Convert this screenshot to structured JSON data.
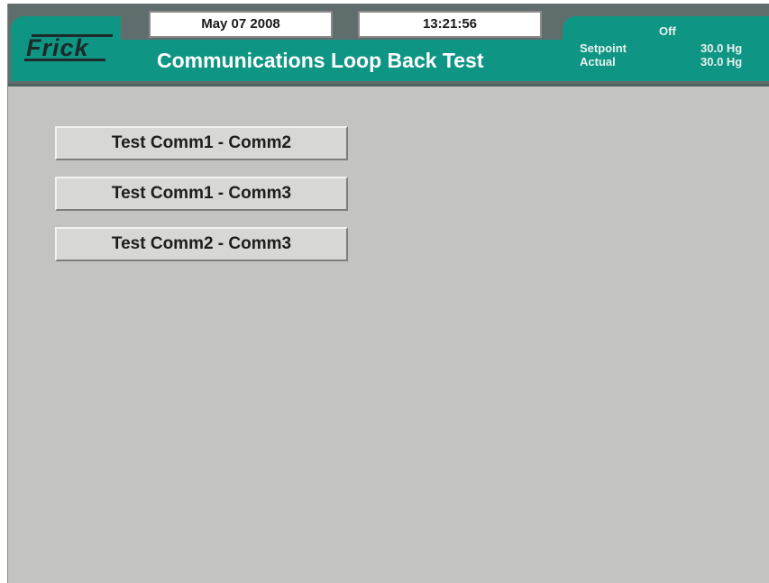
{
  "header": {
    "date": "May 07 2008",
    "time": "13:21:56",
    "logo_text": "Frick",
    "title": "Communications Loop Back Test",
    "status": {
      "state": "Off",
      "setpoint_label": "Setpoint",
      "setpoint_value": "30.0 Hg",
      "actual_label": "Actual",
      "actual_value": "30.0 Hg"
    }
  },
  "buttons": [
    {
      "label": "Test Comm1 - Comm2"
    },
    {
      "label": "Test Comm1 - Comm3"
    },
    {
      "label": "Test Comm2 - Comm3"
    }
  ],
  "colors": {
    "header_teal": "#0f9583",
    "header_dark": "#5f6e6c",
    "screen_background": "#c3c3c1",
    "button_face": "#d7d7d5"
  }
}
